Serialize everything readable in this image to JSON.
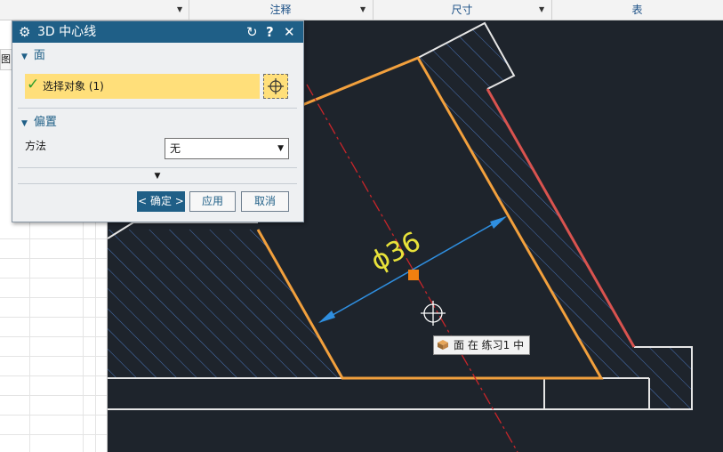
{
  "ribbon": {
    "groups": [
      {
        "label": ""
      },
      {
        "label": "注释"
      },
      {
        "label": "尺寸"
      },
      {
        "label": "表"
      }
    ]
  },
  "left_panel": {
    "tab_label": "图"
  },
  "dialog": {
    "title": "3D 中心线",
    "sections": {
      "face": {
        "title": "面",
        "select_label": "选择对象 (1)"
      },
      "offset": {
        "title": "偏置",
        "method_label": "方法",
        "method_value": "无"
      }
    },
    "buttons": {
      "ok": "< 确定 >",
      "apply": "应用",
      "cancel": "取消"
    }
  },
  "canvas": {
    "dimension_text": "ϕ36",
    "tooltip": "面 在 练习1 中"
  },
  "colors": {
    "canvas_bg": "#1e242c",
    "edge_white": "#e6e6e6",
    "edge_orange": "#f2a03d",
    "edge_red": "#d9534f",
    "hatch": "#4a74b8",
    "centerline": "#c8252a",
    "dimension": "#2f8fe0",
    "dimension_text": "#e8e23a",
    "dialog_title": "#1f5f87",
    "selection_highlight": "#ffdf7a"
  }
}
